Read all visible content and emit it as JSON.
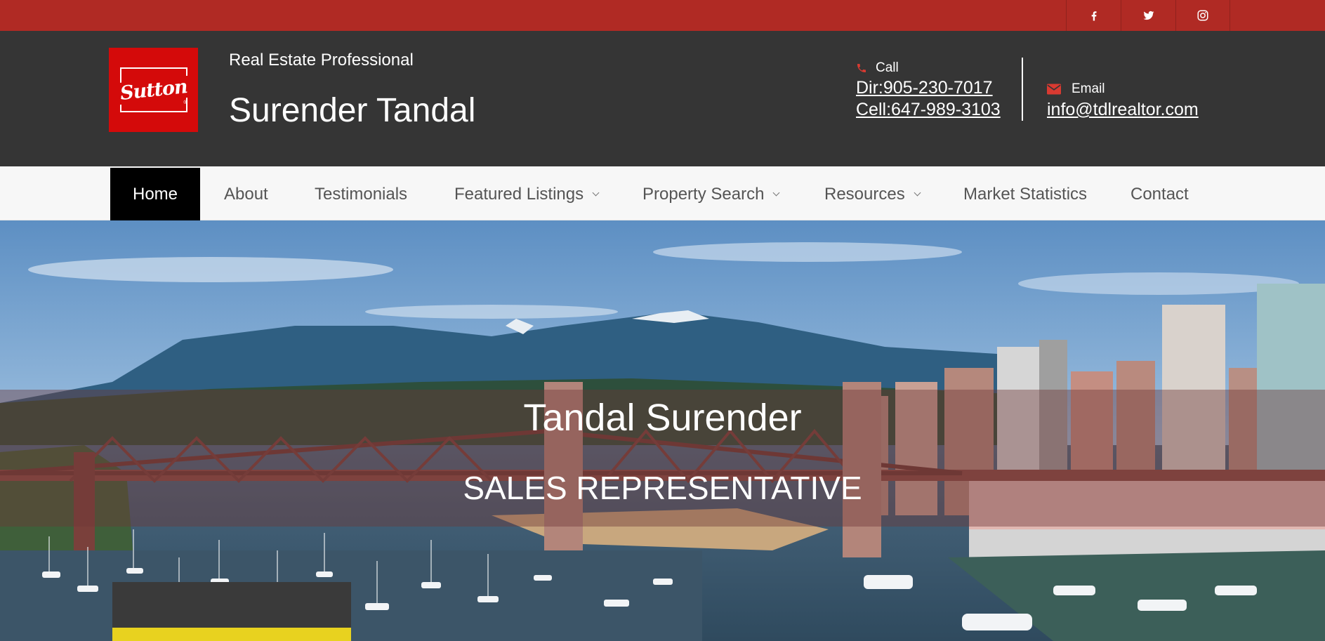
{
  "social": {
    "items": [
      {
        "name": "facebook",
        "icon": "facebook-icon"
      },
      {
        "name": "twitter",
        "icon": "twitter-icon"
      },
      {
        "name": "instagram",
        "icon": "instagram-icon"
      }
    ]
  },
  "header": {
    "logo_text": "Sutton",
    "logo_mark": "®",
    "tagline": "Real Estate Professional",
    "agent_name": "Surender Tandal",
    "call_label": "Call",
    "call_icon": "phone-icon",
    "phone_direct": "Dir:905-230-7017",
    "phone_cell": "Cell:647-989-3103",
    "email_label": "Email",
    "email_icon": "envelope-icon",
    "email": "info@tdlrealtor.com"
  },
  "nav": {
    "items": [
      {
        "label": "Home",
        "active": true
      },
      {
        "label": "About"
      },
      {
        "label": "Testimonials"
      },
      {
        "label": "Featured Listings",
        "dropdown": true
      },
      {
        "label": "Property Search",
        "dropdown": true
      },
      {
        "label": "Resources",
        "dropdown": true
      },
      {
        "label": "Market Statistics"
      },
      {
        "label": "Contact"
      }
    ]
  },
  "hero": {
    "name": "Tandal Surender",
    "title": "SALES REPRESENTATIVE"
  },
  "colors": {
    "topbar": "#b02a24",
    "header": "#353535",
    "brand_red": "#d40a0a",
    "nav_active": "#000000"
  }
}
